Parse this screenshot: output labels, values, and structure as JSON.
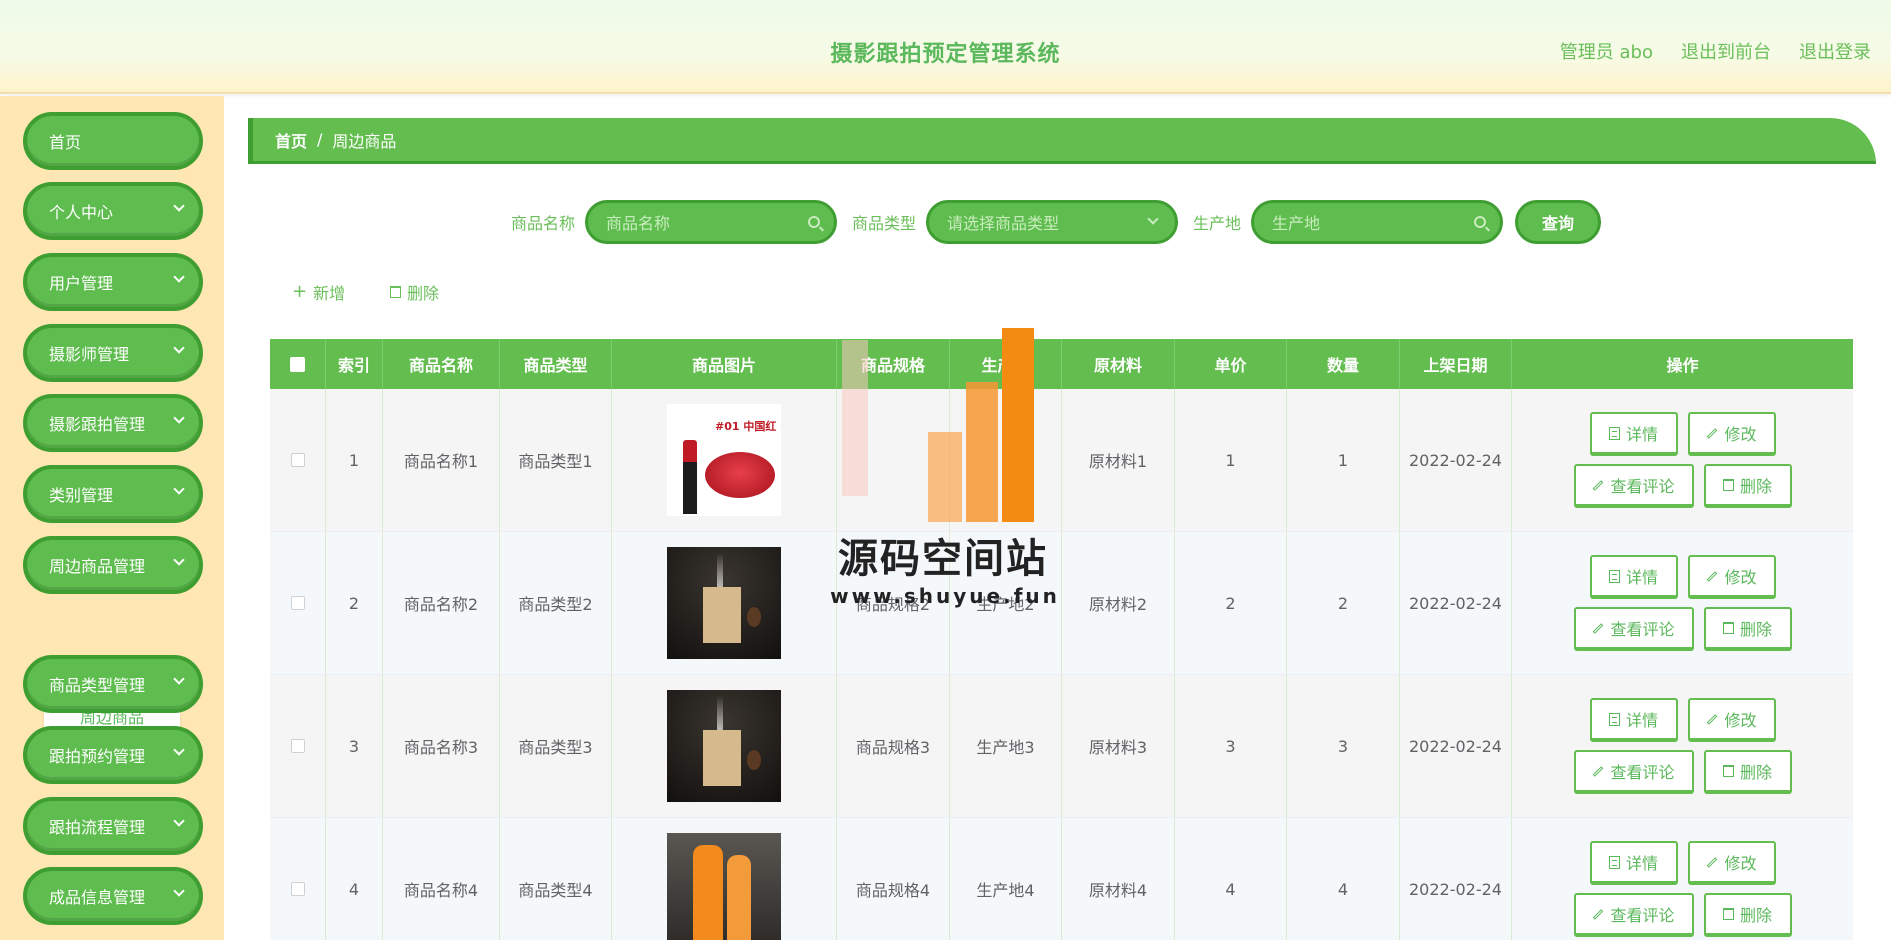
{
  "header": {
    "title": "摄影跟拍预定管理系统",
    "user": "管理员 abo",
    "to_front": "退出到前台",
    "logout": "退出登录"
  },
  "sidebar": {
    "items": [
      {
        "label": "首页"
      },
      {
        "label": "个人中心"
      },
      {
        "label": "用户管理"
      },
      {
        "label": "摄影师管理"
      },
      {
        "label": "摄影跟拍管理"
      },
      {
        "label": "类别管理"
      },
      {
        "label": "周边商品管理"
      },
      {
        "label": "商品类型管理"
      },
      {
        "label": "跟拍预约管理"
      },
      {
        "label": "跟拍流程管理"
      },
      {
        "label": "成品信息管理"
      }
    ],
    "submenu_label": "周边商品"
  },
  "breadcrumb": {
    "home": "首页",
    "sep": "/",
    "current": "周边商品"
  },
  "search": {
    "name_label": "商品名称",
    "name_placeholder": "商品名称",
    "type_label": "商品类型",
    "type_placeholder": "请选择商品类型",
    "origin_label": "生产地",
    "origin_placeholder": "生产地",
    "query_button": "查询"
  },
  "actions": {
    "add": "新增",
    "delete": "删除"
  },
  "table": {
    "columns": [
      "索引",
      "商品名称",
      "商品类型",
      "商品图片",
      "商品规格",
      "生产地",
      "原材料",
      "单价",
      "数量",
      "上架日期",
      "操作"
    ],
    "rows": [
      {
        "index": "1",
        "name": "商品名称1",
        "type": "商品类型1",
        "image": "lipstick",
        "spec": "",
        "origin": "",
        "material": "原材料1",
        "price": "1",
        "qty": "1",
        "date": "2022-02-24"
      },
      {
        "index": "2",
        "name": "商品名称2",
        "type": "商品类型2",
        "image": "incense",
        "spec": "商品规格2",
        "origin": "生产地2",
        "material": "原材料2",
        "price": "2",
        "qty": "2",
        "date": "2022-02-24"
      },
      {
        "index": "3",
        "name": "商品名称3",
        "type": "商品类型3",
        "image": "incense",
        "spec": "商品规格3",
        "origin": "生产地3",
        "material": "原材料3",
        "price": "3",
        "qty": "3",
        "date": "2022-02-24"
      },
      {
        "index": "4",
        "name": "商品名称4",
        "type": "商品类型4",
        "image": "skincare",
        "spec": "商品规格4",
        "origin": "生产地4",
        "material": "原材料4",
        "price": "4",
        "qty": "4",
        "date": "2022-02-24"
      }
    ],
    "op_labels": {
      "detail": "详情",
      "edit": "修改",
      "comments": "查看评论",
      "delete": "删除"
    }
  },
  "watermark": {
    "text": "源码空间站",
    "url": "www.shuyue.fun"
  },
  "colors": {
    "primary": "#63bd4f",
    "primary_dark": "#3f9e32",
    "sidebar_bg": "#ffe7b4"
  }
}
